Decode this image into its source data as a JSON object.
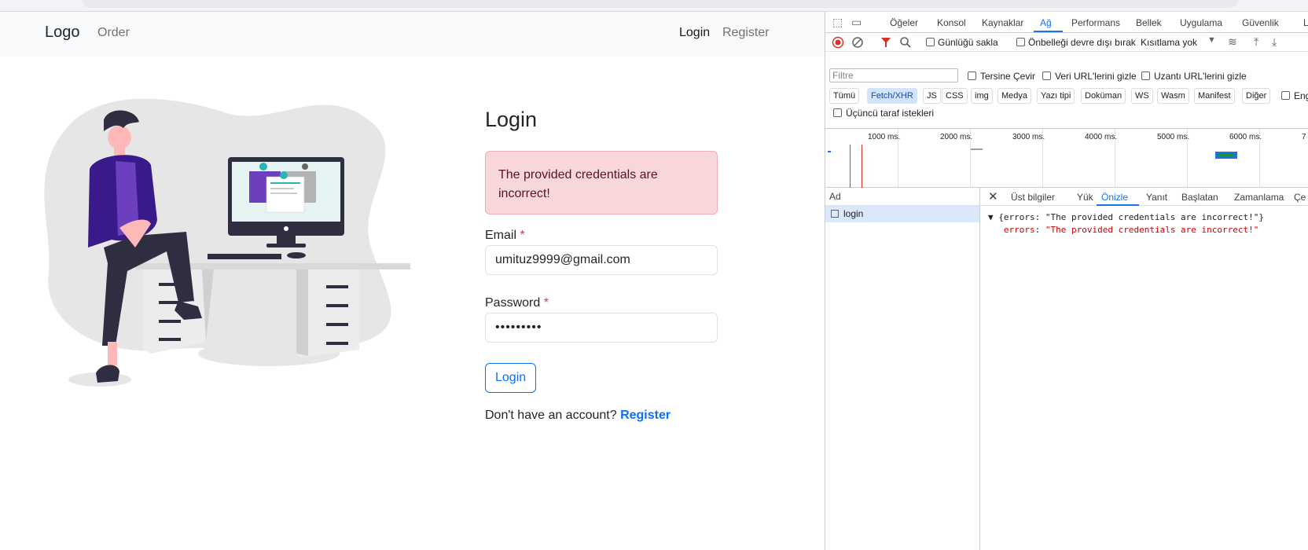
{
  "navbar": {
    "brand": "Logo",
    "order_link": "Order",
    "login_link": "Login",
    "register_link": "Register"
  },
  "login": {
    "title": "Login",
    "alert": "The provided credentials are incorrect!",
    "email_label": "Email",
    "email_value": "umituz9999@gmail.com",
    "password_label": "Password",
    "password_value": "•••••••••",
    "required_marker": "*",
    "submit": "Login",
    "no_account_text": "Don't have an account?",
    "register_link": "Register"
  },
  "devtools": {
    "tabs": [
      "Öğeler",
      "Konsol",
      "Kaynaklar",
      "Ağ",
      "Performans",
      "Bellek",
      "Uygulama",
      "Güvenlik",
      "L"
    ],
    "active_tab": "Ağ",
    "toolbar": {
      "preserve_log": "Günlüğü sakla",
      "disable_cache": "Önbelleği devre dışı bırak",
      "throttle": "Kısıtlama yok"
    },
    "filter": {
      "placeholder": "Filtre",
      "invert": "Tersine Çevir",
      "hide_data_urls": "Veri URL'lerini gizle",
      "hide_ext_urls": "Uzantı URL'lerini gizle",
      "third_party": "Üçüncü taraf istekleri",
      "blocked": "Eng"
    },
    "chips": [
      "Tümü",
      "Fetch/XHR",
      "JS",
      "CSS",
      "img",
      "Medya",
      "Yazı tipi",
      "Doküman",
      "WS",
      "Wasm",
      "Manifest",
      "Diğer"
    ],
    "active_chip": "Fetch/XHR",
    "timeline_ticks": [
      "1000 ms.",
      "2000 ms.",
      "3000 ms.",
      "4000 ms.",
      "5000 ms.",
      "6000 ms.",
      "7"
    ],
    "name_header": "Ad",
    "request_name": "login",
    "detail_tabs": [
      "Üst bilgiler",
      "Yük",
      "Önizle",
      "Yanıt",
      "Başlatan",
      "Zamanlama",
      "Çe"
    ],
    "active_detail_tab": "Önizle",
    "preview_line1": "{errors: \"The provided credentials are incorrect!\"}",
    "preview_key": "errors",
    "preview_value": "\"The provided credentials are incorrect!\""
  },
  "colors": {
    "primary": "#0d6efd",
    "danger_bg": "#f8d7da",
    "danger_text": "#58151c",
    "devtools_accent": "#1a73e8"
  }
}
